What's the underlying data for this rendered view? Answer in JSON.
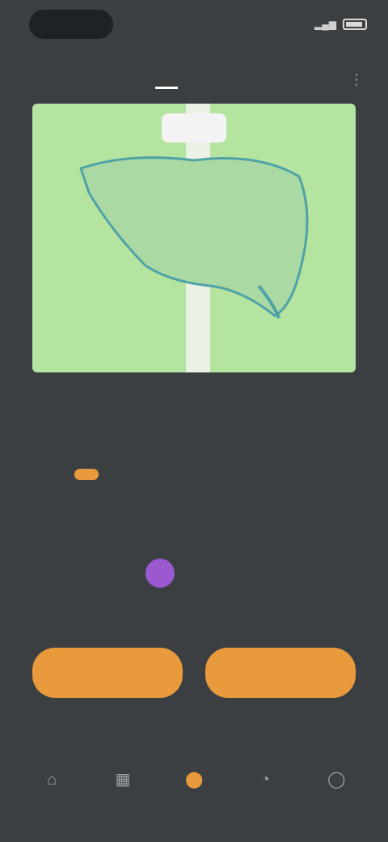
{
  "status_bar": {
    "time": "",
    "right_text": ""
  },
  "tabs": [
    {
      "label": "",
      "active": true
    },
    {
      "label": "",
      "active": false
    }
  ],
  "map": {
    "badge": "",
    "labels": [
      "",
      ""
    ],
    "colors": {
      "land": "#b5e3a0",
      "route": "#4fa3a6"
    }
  },
  "title": "",
  "subtitle": "",
  "info_text": "",
  "section_title": {
    "main": "",
    "accent": ""
  },
  "user": {
    "name": ""
  },
  "note": "",
  "buttons": {
    "left": "",
    "right": ""
  },
  "nav": [
    {
      "icon": "home-icon",
      "label": "",
      "active": false
    },
    {
      "icon": "grid-icon",
      "label": "",
      "active": false
    },
    {
      "icon": "location-icon",
      "label": "",
      "active": true
    },
    {
      "icon": "chat-icon",
      "label": "",
      "active": false
    },
    {
      "icon": "profile-icon",
      "label": "",
      "active": false
    }
  ],
  "colors": {
    "accent": "#e99a3c",
    "background": "#3b3f42",
    "avatar": "#9b59d0"
  }
}
